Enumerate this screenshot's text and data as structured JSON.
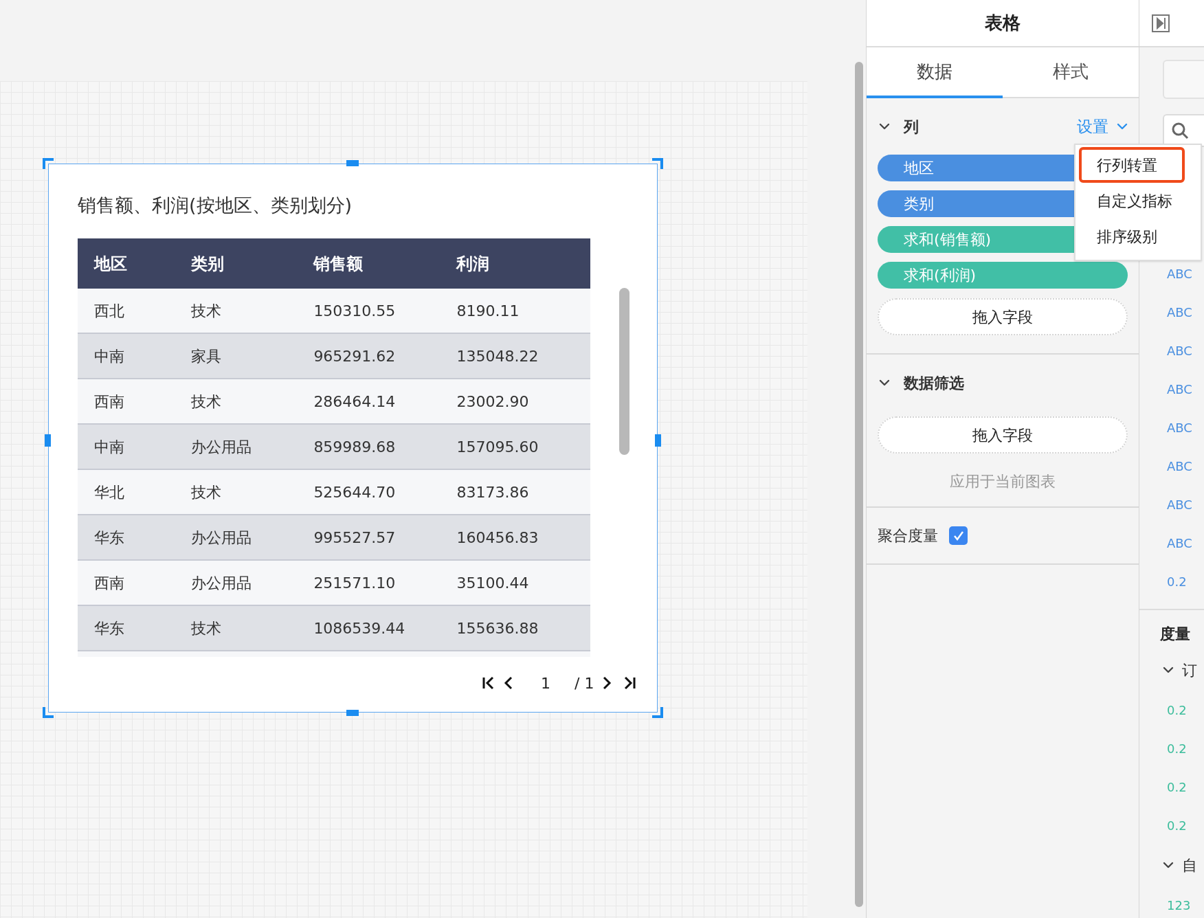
{
  "chart_widget": {
    "title": "销售额、利润(按地区、类别划分)",
    "table": {
      "columns": [
        "地区",
        "类别",
        "销售额",
        "利润"
      ],
      "rows": [
        [
          "西北",
          "技术",
          "150310.55",
          "8190.11"
        ],
        [
          "中南",
          "家具",
          "965291.62",
          "135048.22"
        ],
        [
          "西南",
          "技术",
          "286464.14",
          "23002.90"
        ],
        [
          "中南",
          "办公用品",
          "859989.68",
          "157095.60"
        ],
        [
          "华北",
          "技术",
          "525644.70",
          "83173.86"
        ],
        [
          "华东",
          "办公用品",
          "995527.57",
          "160456.83"
        ],
        [
          "西南",
          "办公用品",
          "251571.10",
          "35100.44"
        ],
        [
          "华东",
          "技术",
          "1086539.44",
          "155636.88"
        ]
      ]
    },
    "pagination": {
      "page": "1",
      "total": "/ 1"
    }
  },
  "panel": {
    "title": "表格",
    "tabs": [
      {
        "label": "数据",
        "selected": true
      },
      {
        "label": "样式",
        "selected": false
      }
    ],
    "columns_section": {
      "title": "列",
      "expanded": true,
      "settings": "设置",
      "fields": [
        {
          "label": "地区",
          "kind": "dimension"
        },
        {
          "label": "类别",
          "kind": "dimension"
        },
        {
          "label": "求和(销售额)",
          "kind": "measure"
        },
        {
          "label": "求和(利润)",
          "kind": "measure"
        }
      ],
      "drop_zone": "拖入字段"
    },
    "filter_section": {
      "title": "数据筛选",
      "expanded": true,
      "drop_zone": "拖入字段",
      "apply_hint": "应用于当前图表"
    },
    "aggregate": {
      "label": "聚合度量",
      "checked": true
    },
    "settings_menu": [
      {
        "label": "行列转置",
        "selected": true
      },
      {
        "label": "自定义指标",
        "selected": false
      },
      {
        "label": "排序级别",
        "selected": false
      }
    ]
  },
  "field_list": {
    "items": [
      {
        "type": "ABC",
        "color": "#4a8fe0"
      },
      {
        "type": "ABC",
        "color": "#4a8fe0"
      },
      {
        "type": "ABC",
        "color": "#4a8fe0"
      },
      {
        "type": "ABC",
        "color": "#4a8fe0"
      },
      {
        "type": "ABC",
        "color": "#4a8fe0"
      },
      {
        "type": "ABC",
        "color": "#4a8fe0"
      },
      {
        "type": "ABC",
        "color": "#4a8fe0"
      },
      {
        "type": "ABC",
        "color": "#4a8fe0"
      },
      {
        "type": "0.2",
        "color": "#4a8fe0"
      }
    ],
    "measures_title": "度量",
    "groups": [
      {
        "label": "订",
        "expanded": true,
        "items": [
          {
            "type": "0.2",
            "color": "#3dbd9c"
          },
          {
            "type": "0.2",
            "color": "#3dbd9c"
          },
          {
            "type": "0.2",
            "color": "#3dbd9c"
          },
          {
            "type": "0.2",
            "color": "#3dbd9c"
          }
        ]
      },
      {
        "label": "自",
        "expanded": true,
        "items": [
          {
            "type": "123",
            "color": "#3dbd9c"
          }
        ]
      }
    ]
  }
}
